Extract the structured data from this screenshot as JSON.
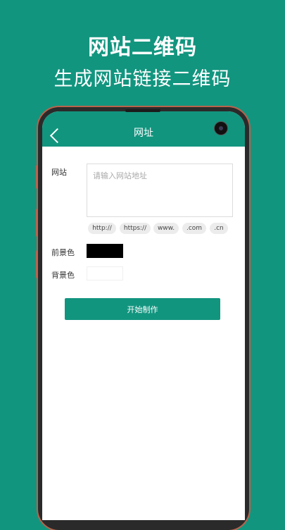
{
  "promo": {
    "title": "网站二维码",
    "subtitle": "生成网站链接二维码"
  },
  "app_bar": {
    "title": "网址",
    "back_icon": "chevron-left-icon",
    "camera_icon": "camera-icon"
  },
  "form": {
    "url_label": "网站",
    "url_value": "",
    "url_placeholder": "请输入网站地址",
    "chips": [
      "http://",
      "https://",
      "www.",
      ".com",
      ".cn"
    ],
    "foreground_label": "前景色",
    "foreground_color": "#000000",
    "background_label": "背景色",
    "background_color": "#ffffff",
    "start_button": "开始制作"
  },
  "colors": {
    "accent": "#12957f",
    "frame": "#b8634c"
  }
}
